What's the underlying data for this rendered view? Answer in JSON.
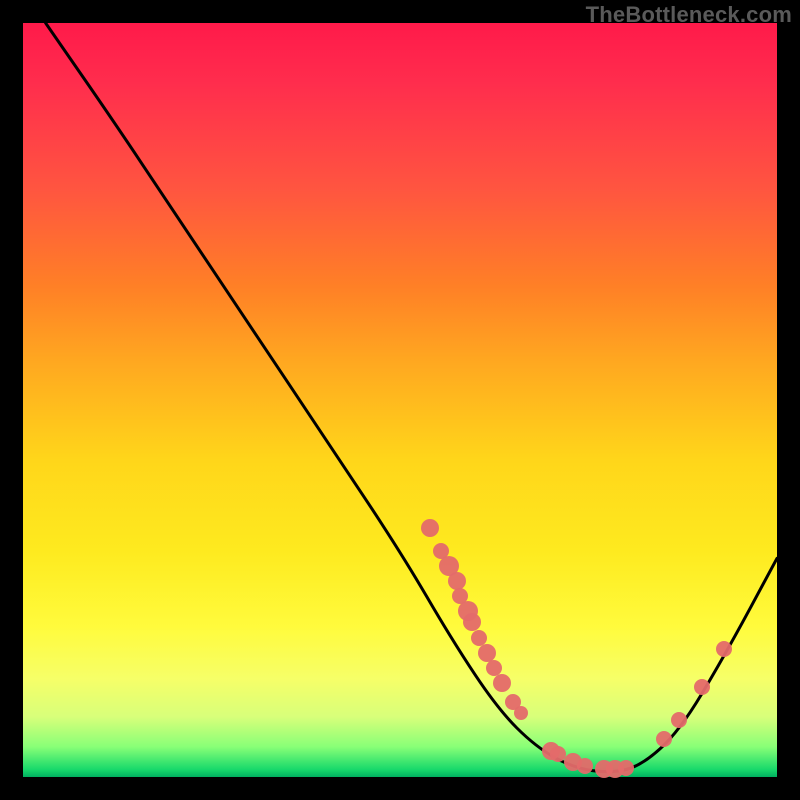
{
  "watermark": "TheBottleneck.com",
  "chart_data": {
    "type": "line",
    "title": "",
    "xlabel": "",
    "ylabel": "",
    "xlim": [
      0,
      100
    ],
    "ylim": [
      0,
      100
    ],
    "grid": false,
    "legend": false,
    "curve": [
      {
        "x": 3,
        "y": 100
      },
      {
        "x": 12,
        "y": 87
      },
      {
        "x": 20,
        "y": 75
      },
      {
        "x": 30,
        "y": 60
      },
      {
        "x": 40,
        "y": 45
      },
      {
        "x": 50,
        "y": 30
      },
      {
        "x": 57,
        "y": 18
      },
      {
        "x": 63,
        "y": 9
      },
      {
        "x": 68,
        "y": 4
      },
      {
        "x": 73,
        "y": 1.2
      },
      {
        "x": 78,
        "y": 0.5
      },
      {
        "x": 82,
        "y": 1.5
      },
      {
        "x": 87,
        "y": 6
      },
      {
        "x": 93,
        "y": 16
      },
      {
        "x": 100,
        "y": 29
      }
    ],
    "markers": [
      {
        "x": 54,
        "y": 33,
        "r": 9
      },
      {
        "x": 55.5,
        "y": 30,
        "r": 8
      },
      {
        "x": 56.5,
        "y": 28,
        "r": 10
      },
      {
        "x": 57.5,
        "y": 26,
        "r": 9
      },
      {
        "x": 58,
        "y": 24,
        "r": 8
      },
      {
        "x": 59,
        "y": 22,
        "r": 10
      },
      {
        "x": 59.5,
        "y": 20.5,
        "r": 9
      },
      {
        "x": 60.5,
        "y": 18.5,
        "r": 8
      },
      {
        "x": 61.5,
        "y": 16.5,
        "r": 9
      },
      {
        "x": 62.5,
        "y": 14.5,
        "r": 8
      },
      {
        "x": 63.5,
        "y": 12.5,
        "r": 9
      },
      {
        "x": 65,
        "y": 10,
        "r": 8
      },
      {
        "x": 66,
        "y": 8.5,
        "r": 7
      },
      {
        "x": 70,
        "y": 3.5,
        "r": 9
      },
      {
        "x": 71,
        "y": 3,
        "r": 8
      },
      {
        "x": 73,
        "y": 2,
        "r": 9
      },
      {
        "x": 74.5,
        "y": 1.5,
        "r": 8
      },
      {
        "x": 77,
        "y": 1,
        "r": 9
      },
      {
        "x": 78.5,
        "y": 1,
        "r": 9
      },
      {
        "x": 80,
        "y": 1.2,
        "r": 8
      },
      {
        "x": 85,
        "y": 5,
        "r": 8
      },
      {
        "x": 87,
        "y": 7.5,
        "r": 8
      },
      {
        "x": 90,
        "y": 12,
        "r": 8
      },
      {
        "x": 93,
        "y": 17,
        "r": 8
      }
    ]
  }
}
